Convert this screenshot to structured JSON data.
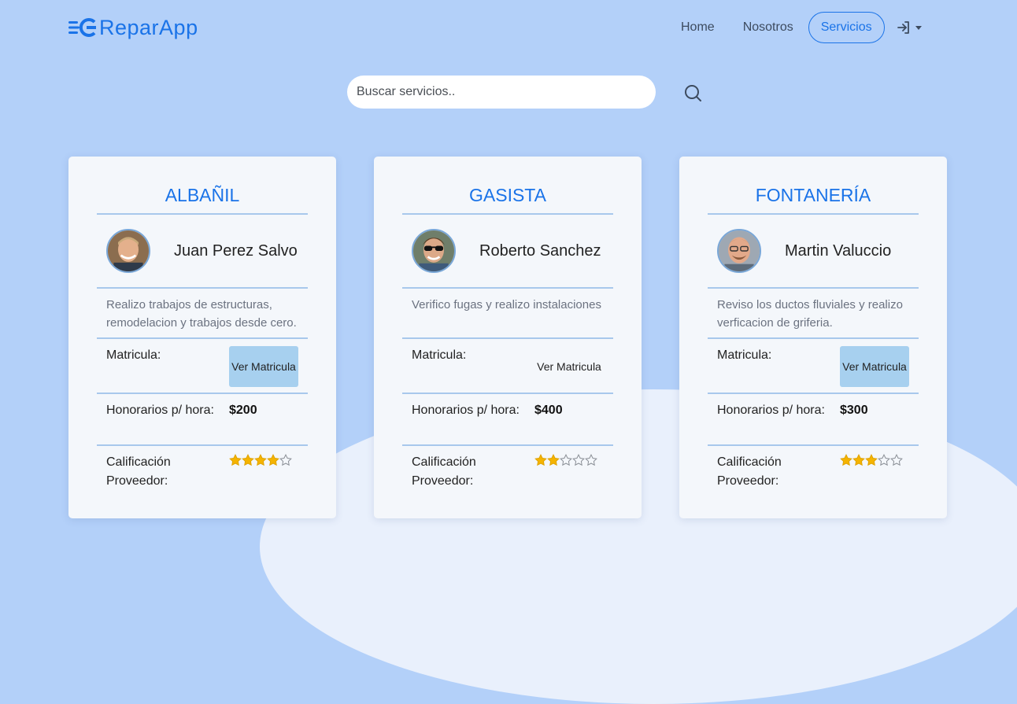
{
  "brand": {
    "name": "ReparApp",
    "accent": "#1a73e8"
  },
  "nav": {
    "links": [
      {
        "label": "Home"
      },
      {
        "label": "Nosotros"
      },
      {
        "label": "Servicios",
        "active": true
      }
    ],
    "login_icon": "login-icon"
  },
  "search": {
    "placeholder": "Buscar servicios..",
    "icon": "search-icon"
  },
  "labels": {
    "matricula": "Matricula:",
    "view_matricula": "Ver Matricula",
    "honorarios": "Honorarios p/ hora:",
    "calificacion": "Calificación Proveedor:"
  },
  "cards": [
    {
      "title": "ALBAÑIL",
      "provider": "Juan Perez Salvo",
      "description": "Realizo trabajos de estructuras, remodelacion y trabajos desde cero.",
      "fee": "$200",
      "rating": 4,
      "rating_max": 5
    },
    {
      "title": "GASISTA",
      "provider": "Roberto Sanchez",
      "description": "Verifico fugas y realizo instalaciones",
      "fee": "$400",
      "rating": 2,
      "rating_max": 5
    },
    {
      "title": "FONTANERÍA",
      "provider": "Martin Valuccio",
      "description": "Reviso los ductos fluviales y realizo verficacion de griferia.",
      "fee": "$300",
      "rating": 3,
      "rating_max": 5
    }
  ]
}
